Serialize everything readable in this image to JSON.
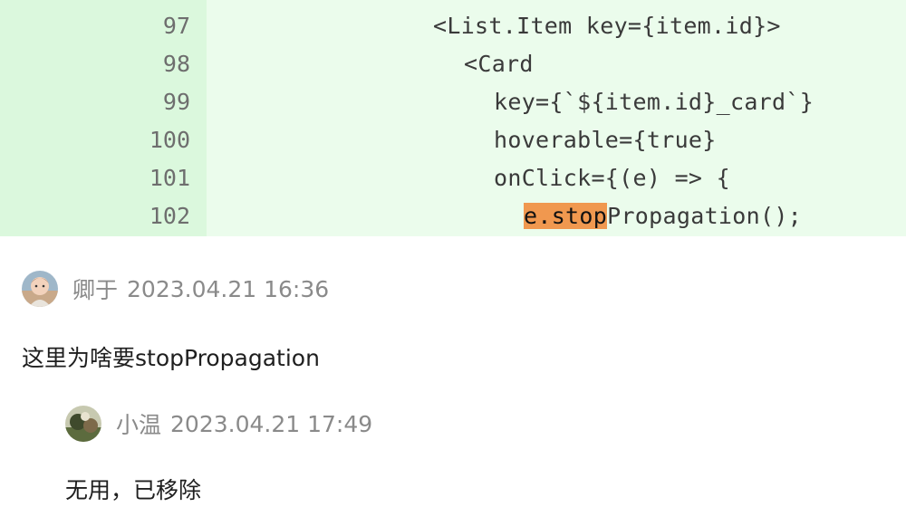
{
  "code": {
    "lines": [
      {
        "number": "97",
        "text": "<List.Item key={item.id}>"
      },
      {
        "number": "98",
        "text": "<Card"
      },
      {
        "number": "99",
        "text": "key={`${item.id}_card`}"
      },
      {
        "number": "100",
        "text": "hoverable={true}"
      },
      {
        "number": "101",
        "text": "onClick={(e) => {"
      },
      {
        "number": "102",
        "highlight": "e.stop",
        "rest": "Propagation();"
      }
    ],
    "colors": {
      "added_bg": "#ebfcec",
      "gutter_bg": "#dbf8dd",
      "highlight": "#f0984f"
    }
  },
  "comments": [
    {
      "author": "卿于",
      "time": "2023.04.21 16:36",
      "body": "这里为啥要stopPropagation",
      "avatar_icon": "baby-photo-avatar"
    },
    {
      "author": "小温",
      "time": "2023.04.21 17:49",
      "body": "无用，已移除",
      "avatar_icon": "photo-avatar"
    }
  ]
}
